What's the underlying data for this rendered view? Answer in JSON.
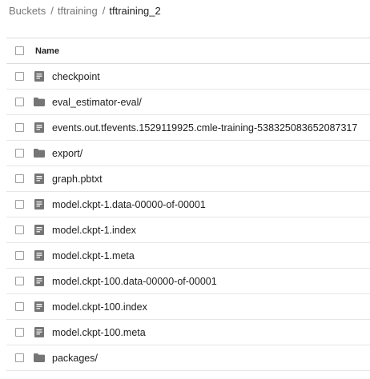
{
  "breadcrumb": {
    "root": "Buckets",
    "bucket": "tftraining",
    "current": "tftraining_2",
    "separator": "/"
  },
  "table": {
    "column_name": "Name"
  },
  "items": [
    {
      "name": "checkpoint",
      "type": "file",
      "icon": "file-icon"
    },
    {
      "name": "eval_estimator-eval/",
      "type": "folder",
      "icon": "folder-icon"
    },
    {
      "name": "events.out.tfevents.1529119925.cmle-training-538325083652087317",
      "type": "file",
      "icon": "file-icon"
    },
    {
      "name": "export/",
      "type": "folder",
      "icon": "folder-icon"
    },
    {
      "name": "graph.pbtxt",
      "type": "file",
      "icon": "file-icon"
    },
    {
      "name": "model.ckpt-1.data-00000-of-00001",
      "type": "file",
      "icon": "file-icon"
    },
    {
      "name": "model.ckpt-1.index",
      "type": "file",
      "icon": "file-icon"
    },
    {
      "name": "model.ckpt-1.meta",
      "type": "file",
      "icon": "file-icon"
    },
    {
      "name": "model.ckpt-100.data-00000-of-00001",
      "type": "file",
      "icon": "file-icon"
    },
    {
      "name": "model.ckpt-100.index",
      "type": "file",
      "icon": "file-icon"
    },
    {
      "name": "model.ckpt-100.meta",
      "type": "file",
      "icon": "file-icon"
    },
    {
      "name": "packages/",
      "type": "folder",
      "icon": "folder-icon"
    }
  ],
  "colors": {
    "icon": "#757575",
    "link": "#757575",
    "text": "#212121",
    "divider": "#e6e6e6"
  }
}
